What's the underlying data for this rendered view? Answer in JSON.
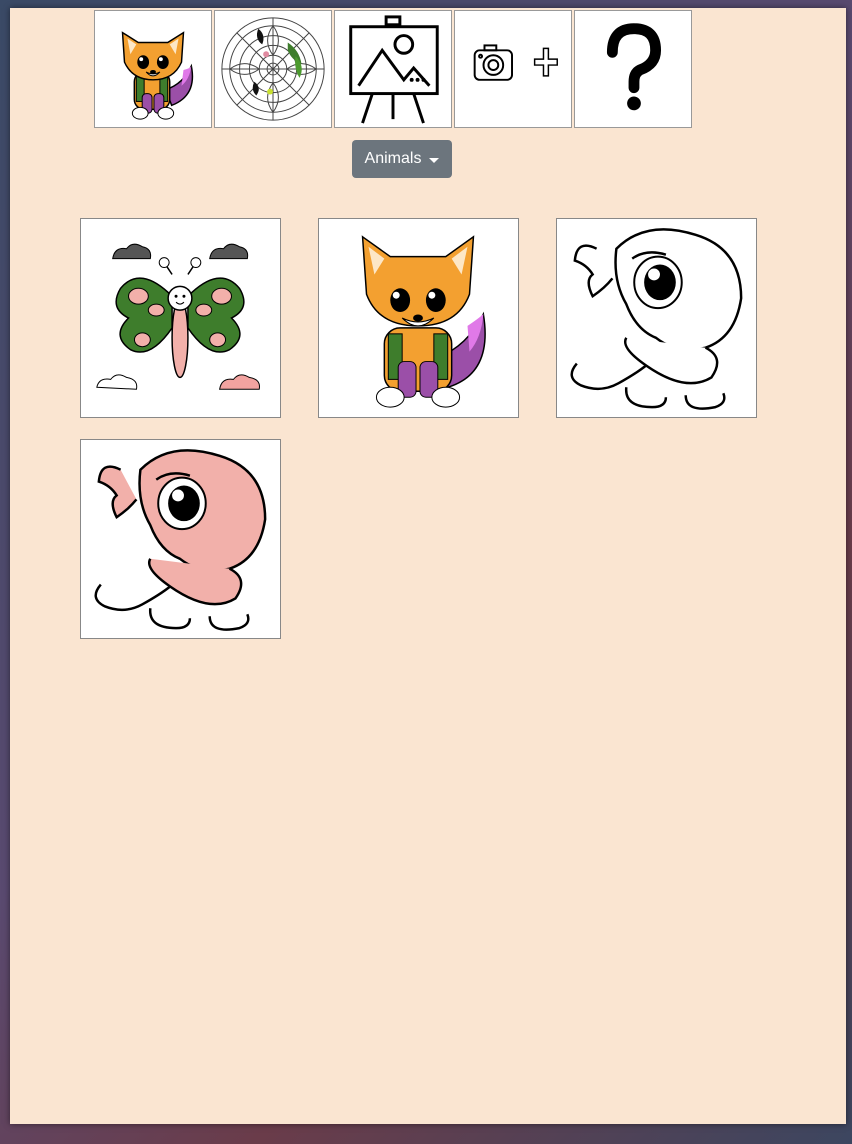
{
  "toolbar": {
    "items": [
      {
        "name": "fox-gallery-icon"
      },
      {
        "name": "mandala-icon"
      },
      {
        "name": "easel-icon"
      },
      {
        "name": "camera-add-icon"
      },
      {
        "name": "help-icon"
      }
    ]
  },
  "category_dropdown": {
    "label": "Animals"
  },
  "gallery": {
    "items": [
      {
        "name": "butterfly"
      },
      {
        "name": "fox"
      },
      {
        "name": "parrot-outline"
      },
      {
        "name": "parrot-pink"
      }
    ]
  },
  "colors": {
    "panel_bg": "#fae5d1",
    "dropdown_bg": "#6c757d",
    "fox_orange": "#f3a030",
    "tail_purple": "#9b4fa8",
    "leaf_green": "#3e7d2c",
    "parrot_pink": "#f2b0aa"
  }
}
